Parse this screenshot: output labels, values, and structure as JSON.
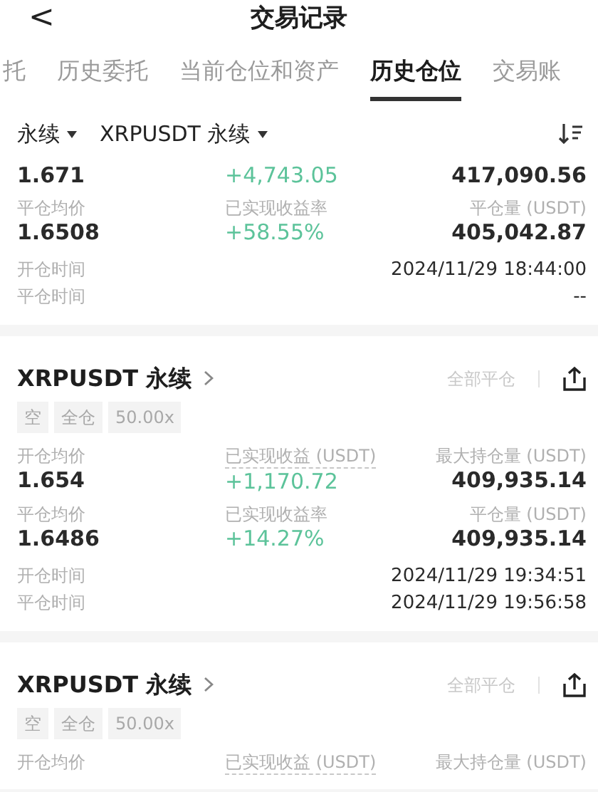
{
  "header": {
    "back": "<",
    "title": "交易记录"
  },
  "tabs": [
    {
      "label": "托",
      "selected": false
    },
    {
      "label": "历史委托",
      "selected": false
    },
    {
      "label": "当前仓位和资产",
      "selected": false
    },
    {
      "label": "历史仓位",
      "selected": true
    },
    {
      "label": "交易账",
      "selected": false
    }
  ],
  "filters": [
    {
      "label": "永续"
    },
    {
      "label": "XRPUSDT 永续"
    }
  ],
  "positions": [
    {
      "rows": [
        [
          {
            "value": "1.671",
            "profit": false
          },
          {
            "value": "+4,743.05",
            "profit": true
          },
          {
            "value": "417,090.56",
            "profit": false
          }
        ],
        [
          {
            "label": "平仓均价",
            "value": "1.6508",
            "profit": false
          },
          {
            "label": "已实现收益率",
            "value": "+58.55%",
            "profit": true
          },
          {
            "label": "平仓量 (USDT)",
            "value": "405,042.87",
            "profit": false
          }
        ]
      ],
      "times": [
        {
          "label": "开仓时间",
          "value": "2024/11/29 18:44:00"
        },
        {
          "label": "平仓时间",
          "value": "--"
        }
      ]
    },
    {
      "title": "XRPUSDT 永续",
      "close_all": "全部平仓",
      "tags": [
        "空",
        "全仓",
        "50.00x"
      ],
      "rows": [
        [
          {
            "label": "开仓均价",
            "value": "1.654",
            "profit": false
          },
          {
            "label": "已实现收益 (USDT)",
            "underlined": true,
            "value": "+1,170.72",
            "profit": true
          },
          {
            "label": "最大持仓量 (USDT)",
            "value": "409,935.14",
            "profit": false
          }
        ],
        [
          {
            "label": "平仓均价",
            "value": "1.6486",
            "profit": false
          },
          {
            "label": "已实现收益率",
            "value": "+14.27%",
            "profit": true
          },
          {
            "label": "平仓量 (USDT)",
            "value": "409,935.14",
            "profit": false
          }
        ]
      ],
      "times": [
        {
          "label": "开仓时间",
          "value": "2024/11/29 19:34:51"
        },
        {
          "label": "平仓时间",
          "value": "2024/11/29 19:56:58"
        }
      ]
    },
    {
      "title": "XRPUSDT 永续",
      "close_all": "全部平仓",
      "tags": [
        "空",
        "全仓",
        "50.00x"
      ],
      "rows": [
        [
          {
            "label": "开仓均价"
          },
          {
            "label": "已实现收益 (USDT)",
            "underlined": true
          },
          {
            "label": "最大持仓量 (USDT)"
          }
        ]
      ]
    }
  ]
}
